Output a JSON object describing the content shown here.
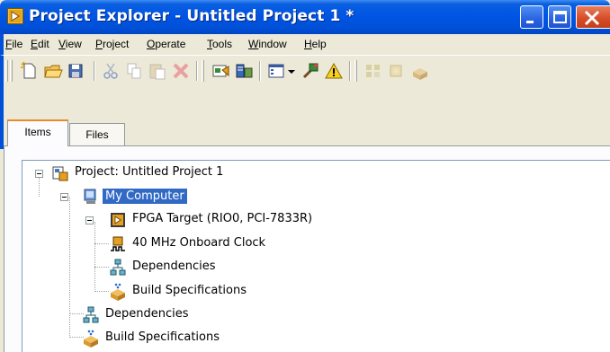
{
  "window": {
    "title": "Project Explorer - Untitled Project 1 *"
  },
  "menu": [
    "File",
    "Edit",
    "View",
    "Project",
    "Operate",
    "Tools",
    "Window",
    "Help"
  ],
  "menu_underline": [
    "F",
    "E",
    "V",
    "P",
    "O",
    "T",
    "W",
    "H"
  ],
  "tabs": {
    "items": "Items",
    "files": "Files"
  },
  "tree": {
    "project": "Project: Untitled Project 1",
    "my_computer": "My Computer",
    "fpga_target": "FPGA Target (RIO0, PCI-7833R)",
    "clock": "40 MHz Onboard Clock",
    "fpga_dependencies": "Dependencies",
    "fpga_build_specs": "Build Specifications",
    "dependencies": "Dependencies",
    "build_specs": "Build Specifications"
  },
  "colors": {
    "titlebar": "#0055e5",
    "selection": "#316ac5",
    "tab_highlight": "#e68b2c"
  }
}
